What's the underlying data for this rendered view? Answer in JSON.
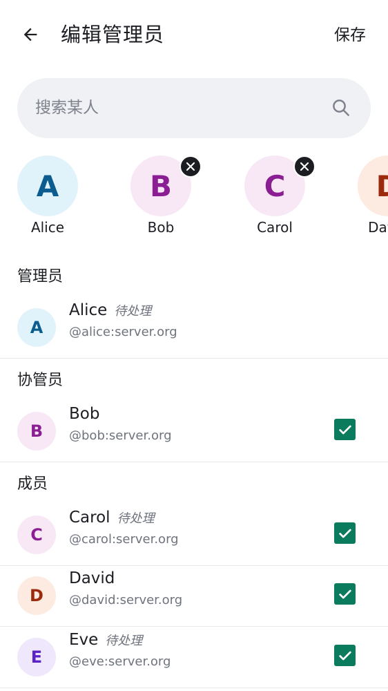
{
  "header": {
    "title": "编辑管理员",
    "save_label": "保存"
  },
  "search": {
    "placeholder": "搜索某人"
  },
  "selected": [
    {
      "initial": "A",
      "name": "Alice",
      "removable": false,
      "bg": "#e1f3fa",
      "fg": "#0b5c8f"
    },
    {
      "initial": "B",
      "name": "Bob",
      "removable": true,
      "bg": "#f8e8f6",
      "fg": "#8a1e92"
    },
    {
      "initial": "C",
      "name": "Carol",
      "removable": true,
      "bg": "#f8e8f6",
      "fg": "#8a1e92"
    },
    {
      "initial": "D",
      "name": "David",
      "removable": false,
      "bg": "#fdebe1",
      "fg": "#9b2b0c"
    }
  ],
  "sections": {
    "admins": "管理员",
    "moderators": "协管员",
    "members": "成员"
  },
  "users": [
    {
      "initial": "A",
      "name": "Alice",
      "handle": "@alice:server.org",
      "pending": "待处理",
      "checked": false,
      "bg": "#e1f3fa",
      "fg": "#0b5c8f"
    },
    {
      "initial": "B",
      "name": "Bob",
      "handle": "@bob:server.org",
      "pending": "",
      "checked": true,
      "bg": "#f8e8f6",
      "fg": "#8a1e92"
    },
    {
      "initial": "C",
      "name": "Carol",
      "handle": "@carol:server.org",
      "pending": "待处理",
      "checked": true,
      "bg": "#f8e8f6",
      "fg": "#8a1e92"
    },
    {
      "initial": "D",
      "name": "David",
      "handle": "@david:server.org",
      "pending": "",
      "checked": true,
      "bg": "#fdebe1",
      "fg": "#9b2b0c"
    },
    {
      "initial": "E",
      "name": "Eve",
      "handle": "@eve:server.org",
      "pending": "待处理",
      "checked": true,
      "bg": "#efe8fc",
      "fg": "#5b22c4"
    }
  ]
}
